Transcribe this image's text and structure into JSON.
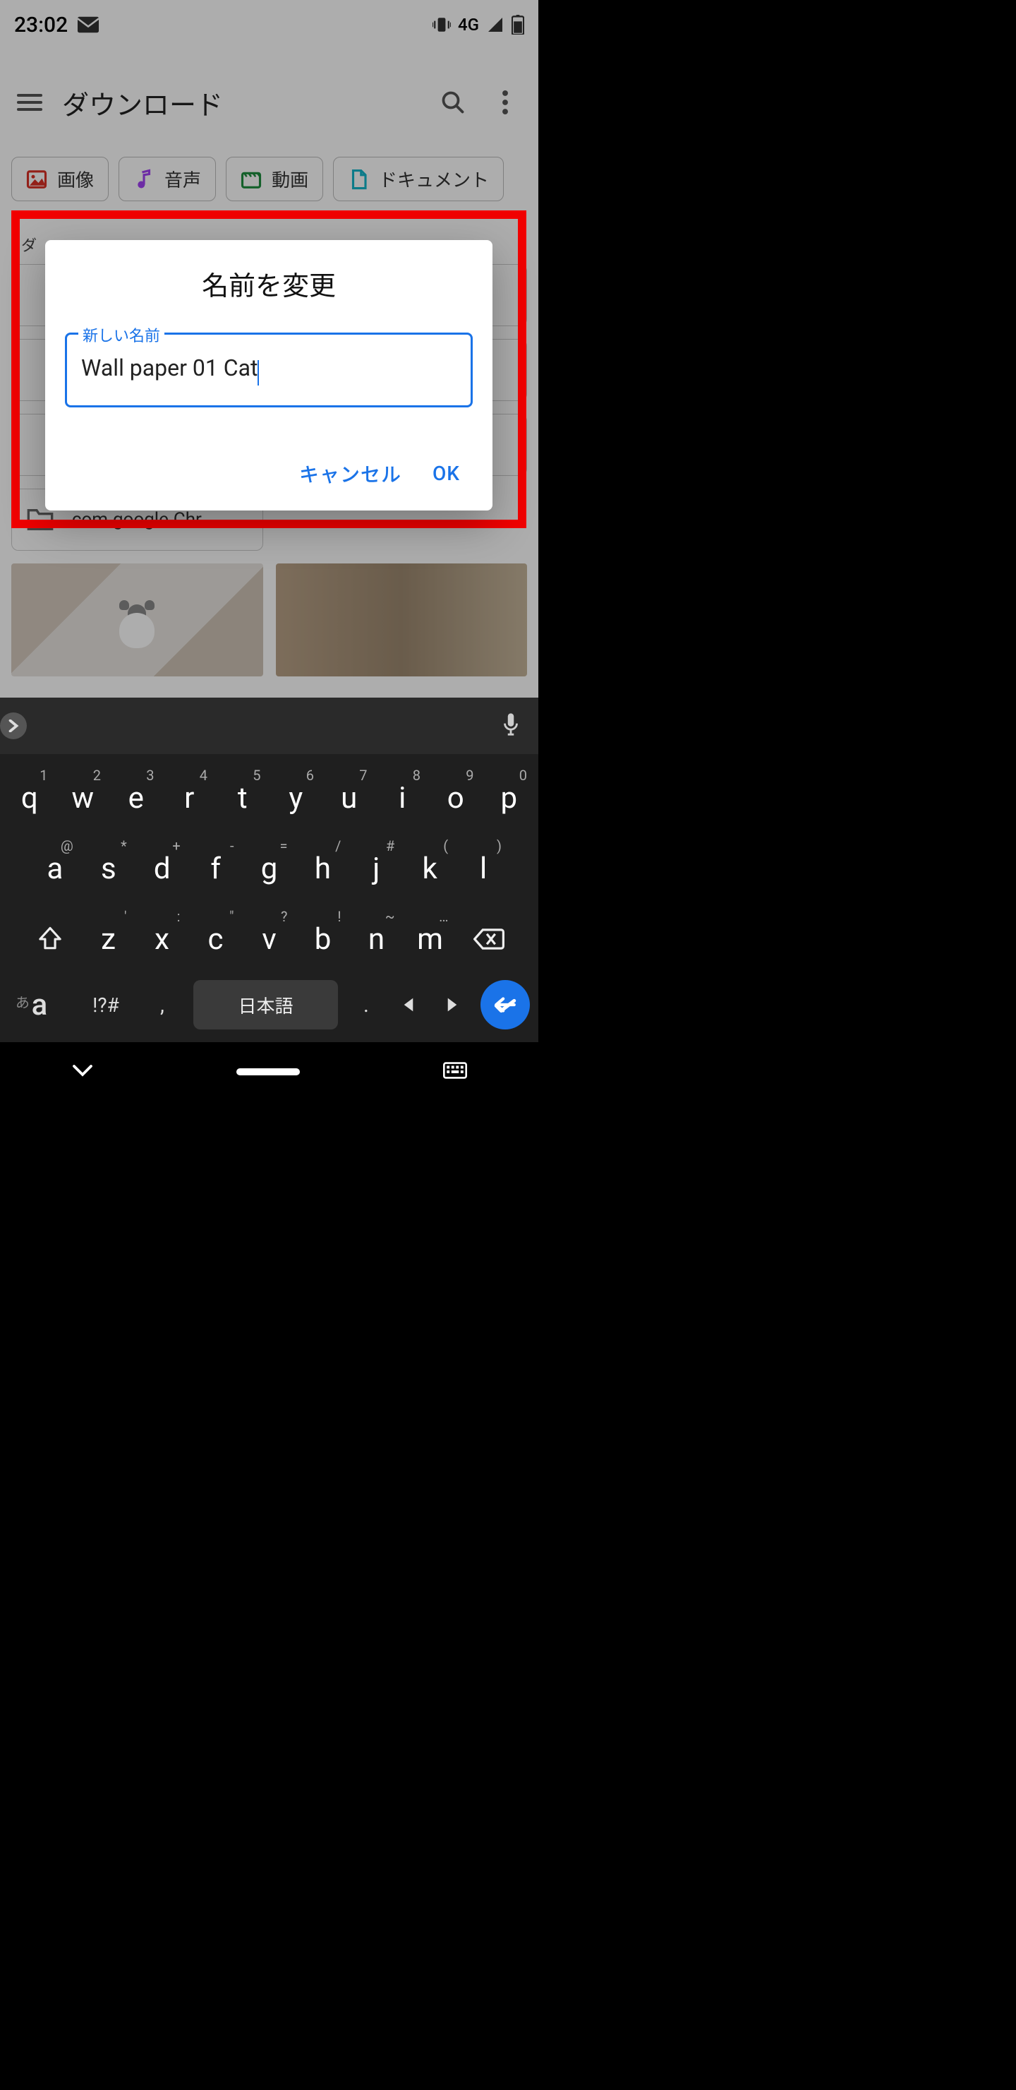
{
  "status_bar": {
    "time": "23:02",
    "network": "4G"
  },
  "app": {
    "title": "ダウンロード"
  },
  "chips": [
    {
      "label": "画像",
      "color": "#d93025"
    },
    {
      "label": "音声",
      "color": "#a142f4"
    },
    {
      "label": "動画",
      "color": "#1e8e3e"
    },
    {
      "label": "ドキュメント",
      "color": "#12b5cb"
    }
  ],
  "section_label": "ダ",
  "folders": [
    {
      "name": ""
    },
    {
      "name": ""
    },
    {
      "name": ""
    },
    {
      "name": ""
    },
    {
      "name": ""
    },
    {
      "name": ""
    },
    {
      "name": ".com.google.Chr…"
    }
  ],
  "dialog": {
    "title": "名前を変更",
    "field_label": "新しい名前",
    "value": "Wall paper 01 Cat",
    "cancel": "キャンセル",
    "ok": "OK"
  },
  "keyboard": {
    "space_label": "日本語",
    "mode_alpha": "a",
    "mode_kana": "あ",
    "mode_sym": "!?#",
    "row1": [
      {
        "k": "q",
        "h": "1"
      },
      {
        "k": "w",
        "h": "2"
      },
      {
        "k": "e",
        "h": "3"
      },
      {
        "k": "r",
        "h": "4"
      },
      {
        "k": "t",
        "h": "5"
      },
      {
        "k": "y",
        "h": "6"
      },
      {
        "k": "u",
        "h": "7"
      },
      {
        "k": "i",
        "h": "8"
      },
      {
        "k": "o",
        "h": "9"
      },
      {
        "k": "p",
        "h": "0"
      }
    ],
    "row2": [
      {
        "k": "a",
        "h": "@"
      },
      {
        "k": "s",
        "h": "*"
      },
      {
        "k": "d",
        "h": "+"
      },
      {
        "k": "f",
        "h": "-"
      },
      {
        "k": "g",
        "h": "="
      },
      {
        "k": "h",
        "h": "/"
      },
      {
        "k": "j",
        "h": "#"
      },
      {
        "k": "k",
        "h": "("
      },
      {
        "k": "l",
        "h": ")"
      }
    ],
    "row3": [
      {
        "k": "z",
        "h": "'"
      },
      {
        "k": "x",
        "h": ":"
      },
      {
        "k": "c",
        "h": "\""
      },
      {
        "k": "v",
        "h": "?"
      },
      {
        "k": "b",
        "h": "!"
      },
      {
        "k": "n",
        "h": "~"
      },
      {
        "k": "m",
        "h": "…"
      }
    ]
  }
}
